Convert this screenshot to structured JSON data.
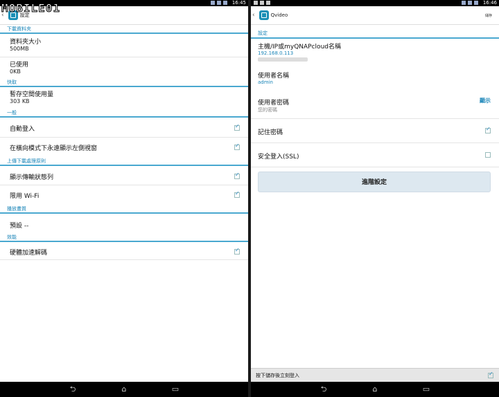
{
  "left": {
    "status_time": "16:45",
    "watermark": "MOBILE01",
    "action_title": "設定",
    "sections": [
      {
        "header": "下載資料夾"
      },
      {
        "header": "快取"
      },
      {
        "header": "一般"
      },
      {
        "header": "上傳下載處理原則"
      },
      {
        "header": "播放畫質"
      },
      {
        "header": "效能"
      }
    ],
    "folder_size_title": "資料夾大小",
    "folder_size_value": "500MB",
    "used_title": "已使用",
    "used_value": "0KB",
    "cache_title": "暫存空間使用量",
    "cache_value": "303 KB",
    "auto_login": "自動登入",
    "landscape_sidebar": "在橫向模式下永遠顯示左側視窗",
    "show_transfer_bar": "顯示傳輸狀態列",
    "wifi_only": "限用 Wi-Fi",
    "quality_value": "預設 --",
    "hw_decode": "硬體加速解碼"
  },
  "right": {
    "status_time": "16:46",
    "action_title": "Qvideo",
    "action_save": "儲存",
    "section_header": "設定",
    "host_title": "主機/IP或myQNAPcloud名稱",
    "host_value": "192.168.0.113",
    "user_title": "使用者名稱",
    "user_value": "admin",
    "pwd_title": "使用者密碼",
    "pwd_hint": "您的密碼",
    "pwd_show": "顯示",
    "remember_pwd": "記住密碼",
    "ssl_login": "安全登入(SSL)",
    "advanced_button": "進階設定",
    "save_login_label": "按下儲存後立刻登入"
  },
  "checks": {
    "auto_login": true,
    "landscape_sidebar": true,
    "show_transfer_bar": true,
    "wifi_only": true,
    "hw_decode": true,
    "remember_pwd": true,
    "ssl_login": false,
    "save_login": true
  },
  "colors": {
    "accent": "#1a85b8",
    "divider": "#49a8d0",
    "button_bg": "#dde8f0"
  }
}
